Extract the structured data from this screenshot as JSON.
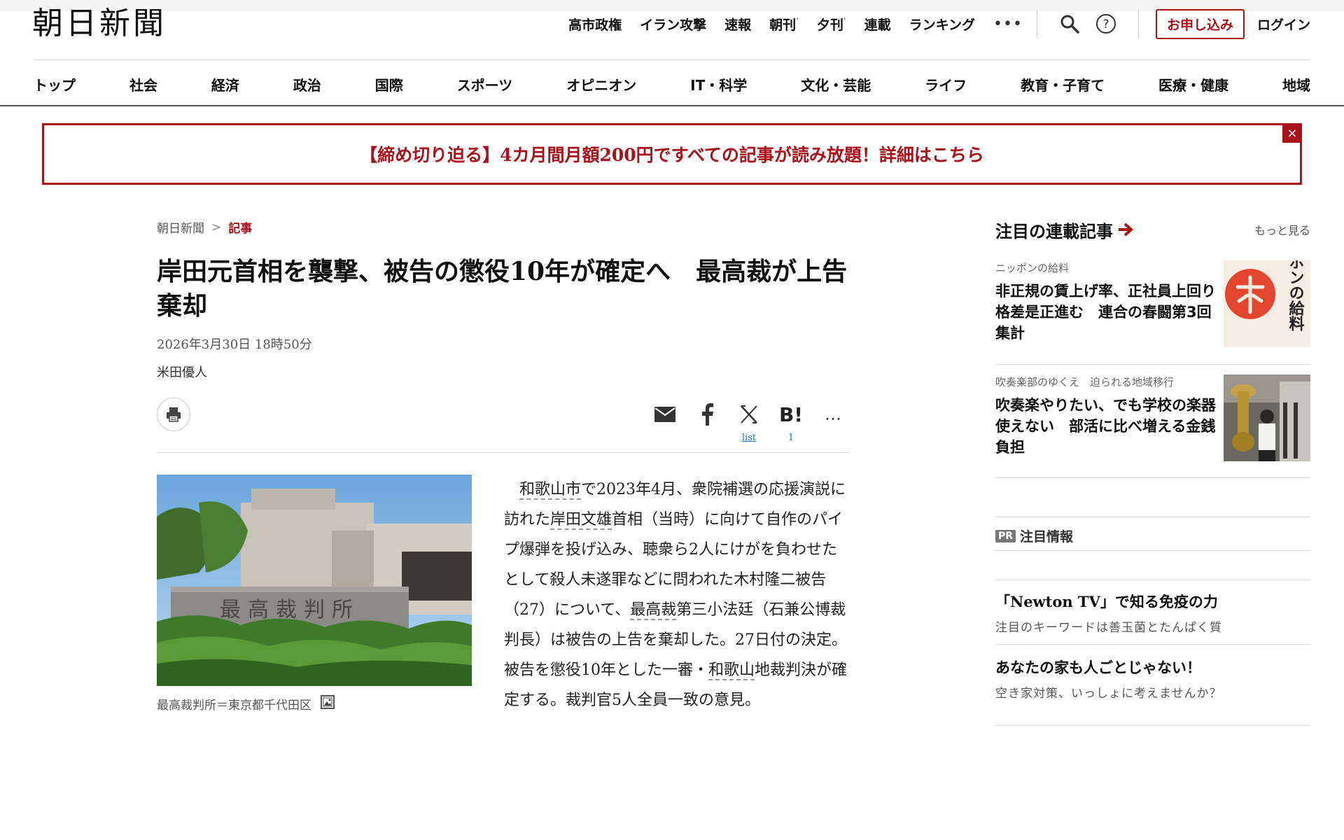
{
  "header": {
    "logo": "朝日新聞",
    "utility_links": [
      "高市政権",
      "イラン攻撃",
      "速報",
      "朝刊",
      "夕刊",
      "連載",
      "ランキング"
    ],
    "more": "•••",
    "apply_label": "お申し込み",
    "login_label": "ログイン"
  },
  "nav": {
    "items": [
      "トップ",
      "社会",
      "経済",
      "政治",
      "国際",
      "スポーツ",
      "オピニオン",
      "IT・科学",
      "文化・芸能",
      "ライフ",
      "教育・子育て",
      "医療・健康",
      "地域"
    ]
  },
  "banner": {
    "text": "【締め切り迫る】4カ月間月額200円ですべての記事が読み放題！詳細はこちら",
    "close": "×"
  },
  "breadcrumb": {
    "home": "朝日新聞",
    "separator": ">",
    "current": "記事"
  },
  "article": {
    "title": "岸田元首相を襲撃、被告の懲役10年が確定へ　最高裁が上告棄却",
    "date": "2026年3月30日 18時50分",
    "author": "米田優人",
    "share": {
      "x_label": "list",
      "hatena_icon": "B!",
      "hatena_count": "1",
      "more": "…"
    },
    "photo_caption": "最高裁判所＝東京都千代田区",
    "photo_sign": "最高裁判所",
    "body": {
      "p1": "和歌山市",
      "p2": "で2023年4月、衆院補選の応援演説に訪れた",
      "p3": "岸田文雄",
      "p4": "首相（当時）に向けて自作のパイプ爆弾を投げ込み、聴衆ら2人にけがを負わせたとして殺人未遂罪などに問われた木村隆二被告（27）について、",
      "p5": "最高裁",
      "p6": "第三小法廷（石兼公博裁判長）は被告の上告を棄却した。27日付の決定。被告を懲役10年とした一審・",
      "p7": "和歌山",
      "p8": "地裁判決が確定する。裁判官5人全員一致の意見。"
    }
  },
  "sidebar": {
    "title": "注目の連載記事",
    "more": "もっと見る",
    "cards": [
      {
        "category": "ニッポンの給料",
        "headline": "非正規の賃上げ率、正社員上回り格差是正進む　連合の春闘第3回集計",
        "thumb_text": "ニッポンの給料"
      },
      {
        "category": "吹奏楽部のゆくえ　迫られる地域移行",
        "headline": "吹奏楽やりたい、でも学校の楽器使えない　部活に比べ増える金銭負担"
      }
    ],
    "pr": {
      "badge": "PR",
      "label": "注目情報",
      "items": [
        {
          "title": "「Newton TV」で知る免疫の力",
          "sub": "注目のキーワードは善玉菌とたんぱく質"
        },
        {
          "title": "あなたの家も人ごとじゃない！",
          "sub": "空き家対策、いっしょに考えませんか？"
        }
      ]
    }
  },
  "colors": {
    "brand_red": "#a9111b",
    "link_blue": "#1a73c8"
  }
}
